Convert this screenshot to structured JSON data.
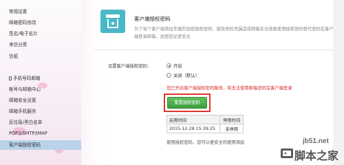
{
  "sidebar": {
    "items": [
      {
        "label": "常规设置"
      },
      {
        "label": "邮箱密码修改"
      },
      {
        "label": "签名/电子名片"
      },
      {
        "label": "来信分类"
      },
      {
        "label": "信纸"
      },
      {
        "label": "手机号码邮箱"
      },
      {
        "label": "帐号与邮箱中心"
      },
      {
        "label": "邮箱安全设置"
      },
      {
        "label": "邮箱手机服务"
      },
      {
        "label": "反垃圾/黑白名单"
      },
      {
        "label": "POP3/SMTP/IMAP"
      },
      {
        "label": "客户端授权密码"
      }
    ],
    "active_index": 11
  },
  "header": {
    "title": "客户端授权密码",
    "description": "为了每个客户端添加专属的加密授权密码，避免密码泄漏造成邮箱安全隐患使用授权密码替代密码在客户端登录邮箱，加密验证更安全"
  },
  "setting": {
    "label": "设置客户端授权密码：",
    "option_on": "开启",
    "option_off": "关闭（默认）",
    "selected": "on",
    "warning": "您已开启客户端授权密码服务，将无法使用邮箱密码在客户端登录"
  },
  "reset_button": {
    "label": "重置授权密码"
  },
  "table": {
    "headers": [
      "启用时间",
      "停用时间"
    ],
    "rows": [
      [
        "2015-12-28 15:39:25",
        "未停用"
      ]
    ]
  },
  "footnote": "使用授权密码，您可以更安全的使用添加",
  "watermark": {
    "url": "jb51.net",
    "name": "脚本之家"
  },
  "colors": {
    "accent_green": "#4caf50",
    "warning_red": "#d92c2c",
    "highlight_red": "#e0362c",
    "icon_teal": "#49b8c8",
    "sidebar_active": "#b9d3ea"
  }
}
